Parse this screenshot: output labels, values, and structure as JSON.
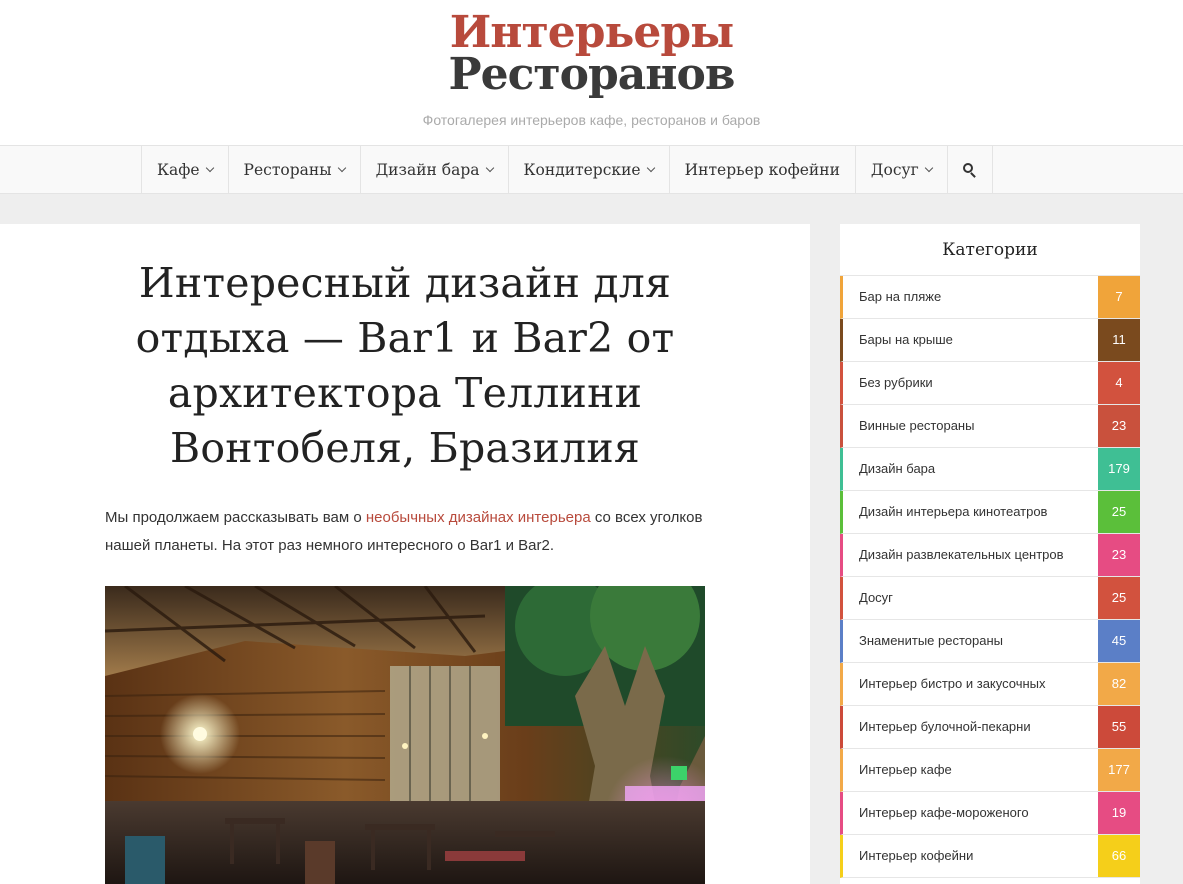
{
  "site": {
    "logo_line1": "Интерьеры",
    "logo_line2": "Ресторанов",
    "tagline": "Фотогалерея интерьеров кафе, ресторанов и баров"
  },
  "nav": {
    "items": [
      {
        "label": "Кафе",
        "dropdown": true
      },
      {
        "label": "Рестораны",
        "dropdown": true
      },
      {
        "label": "Дизайн бара",
        "dropdown": true
      },
      {
        "label": "Кондитерские",
        "dropdown": true
      },
      {
        "label": "Интерьер кофейни",
        "dropdown": false
      },
      {
        "label": "Досуг",
        "dropdown": true
      }
    ],
    "search_icon": "search-icon"
  },
  "article": {
    "title": "Интересный дизайн для отдыха — Bar1 и Bar2 от архитектора Теллини Вонтобеля, Бразилия",
    "intro_before": "Мы продолжаем рассказывать вам о ",
    "intro_link": "необычных дизайнах интерьера",
    "intro_after": " со всех уголков нашей планеты. На этот раз немного интересного о Bar1 и Bar2."
  },
  "sidebar": {
    "title": "Категории",
    "categories": [
      {
        "name": "Бар на пляже",
        "count": "7",
        "color": "#f0a43a"
      },
      {
        "name": "Бары на крыше",
        "count": "11",
        "color": "#7a4a1e"
      },
      {
        "name": "Без рубрики",
        "count": "4",
        "color": "#d2523e"
      },
      {
        "name": "Винные рестораны",
        "count": "23",
        "color": "#c9513d"
      },
      {
        "name": "Дизайн бара",
        "count": "179",
        "color": "#3fbf94"
      },
      {
        "name": "Дизайн интерьера кинотеатров",
        "count": "25",
        "color": "#5bbf3a"
      },
      {
        "name": "Дизайн развлекательных центров",
        "count": "23",
        "color": "#e64c83"
      },
      {
        "name": "Досуг",
        "count": "25",
        "color": "#d2523e"
      },
      {
        "name": "Знаменитые рестораны",
        "count": "45",
        "color": "#5b7fc7"
      },
      {
        "name": "Интерьер бистро и закусочных",
        "count": "82",
        "color": "#f2a948"
      },
      {
        "name": "Интерьер булочной-пекарни",
        "count": "55",
        "color": "#cc4a3a"
      },
      {
        "name": "Интерьер кафе",
        "count": "177",
        "color": "#f2a948"
      },
      {
        "name": "Интерьер кафе-мороженого",
        "count": "19",
        "color": "#e64c83"
      },
      {
        "name": "Интерьер кофейни",
        "count": "66",
        "color": "#f5cf1a"
      }
    ]
  }
}
